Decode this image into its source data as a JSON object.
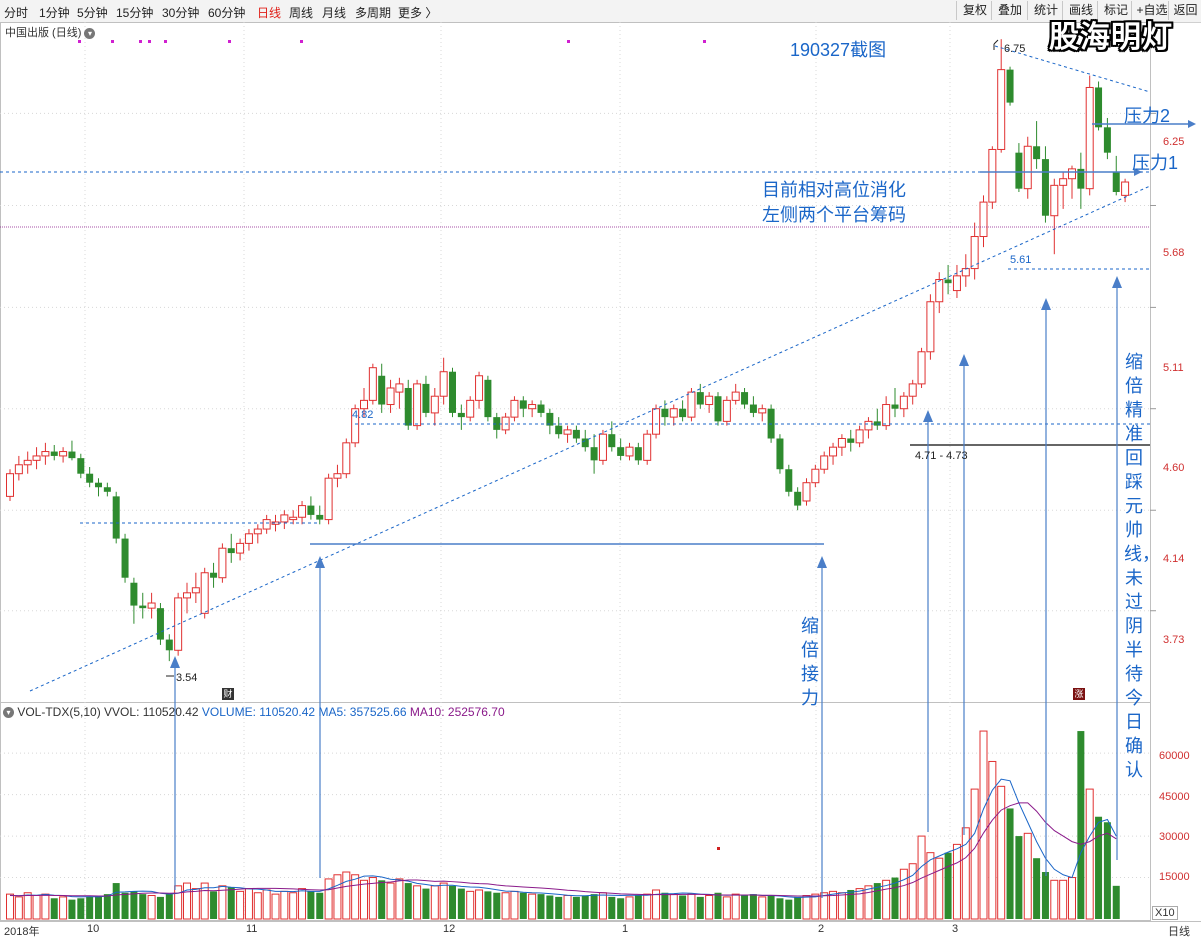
{
  "toolbar": {
    "periods": [
      "分时",
      "1分钟",
      "5分钟",
      "15分钟",
      "30分钟",
      "60分钟",
      "日线",
      "周线",
      "月线",
      "多周期",
      "更多 〉"
    ],
    "active_period": "日线",
    "right_buttons": [
      "复权",
      "叠加",
      "统计",
      "画线",
      "标记",
      "+自选",
      "返回"
    ]
  },
  "logo": "股海明灯",
  "stock_title": "中国出版 (日线)",
  "annotations": {
    "date_note": "190327截图",
    "high_label": "6.75",
    "low_label": "3.54",
    "level_482": "4.82",
    "level_561": "5.61",
    "range_label": "4.71 - 4.73",
    "pressure2": "压力2",
    "pressure1": "压力1",
    "note_line1": "目前相对高位消化",
    "note_line2": "左侧两个平台筹码",
    "shrink_label": "缩倍接力",
    "right_note": "缩倍精准回踩元帅线，未过阴半待今日确认",
    "cai_badge": "财",
    "zhang_badge": "涨"
  },
  "price_axis": {
    "labels": [
      "6.25",
      "5.68",
      "5.11",
      "4.60",
      "4.14",
      "3.73"
    ]
  },
  "volume_legend": {
    "name": "VOL-TDX(5,10)",
    "vvol": "VVOL: 110520.42",
    "volume": "VOLUME: 110520.42",
    "ma5": "MA5: 357525.66",
    "ma10": "MA10: 252576.70"
  },
  "volume_axis": {
    "labels": [
      "60000",
      "45000",
      "30000",
      "15000"
    ],
    "unit": "X10"
  },
  "x_axis": {
    "labels": [
      "2018年",
      "10",
      "11",
      "12",
      "1",
      "2",
      "3"
    ],
    "right_label": "日线"
  },
  "colors": {
    "up": "#e03030",
    "down": "#2e8b2e",
    "annotation": "#1a66c8",
    "ma5": "#1a66c8",
    "ma10": "#8a1a8a"
  },
  "chart_data": {
    "type": "candlestick",
    "ohlc": [
      [
        4.2,
        4.32,
        4.18,
        4.3
      ],
      [
        4.3,
        4.38,
        4.27,
        4.34
      ],
      [
        4.34,
        4.4,
        4.3,
        4.36
      ],
      [
        4.36,
        4.42,
        4.32,
        4.38
      ],
      [
        4.38,
        4.44,
        4.34,
        4.4
      ],
      [
        4.4,
        4.43,
        4.36,
        4.38
      ],
      [
        4.38,
        4.42,
        4.35,
        4.4
      ],
      [
        4.4,
        4.45,
        4.36,
        4.37
      ],
      [
        4.37,
        4.39,
        4.28,
        4.3
      ],
      [
        4.3,
        4.33,
        4.24,
        4.26
      ],
      [
        4.26,
        4.28,
        4.2,
        4.24
      ],
      [
        4.24,
        4.26,
        4.2,
        4.22
      ],
      [
        4.2,
        4.22,
        4.0,
        4.02
      ],
      [
        4.02,
        4.04,
        3.84,
        3.86
      ],
      [
        3.84,
        3.86,
        3.68,
        3.75
      ],
      [
        3.75,
        3.8,
        3.7,
        3.74
      ],
      [
        3.74,
        3.8,
        3.7,
        3.76
      ],
      [
        3.74,
        3.76,
        3.6,
        3.62
      ],
      [
        3.62,
        3.64,
        3.54,
        3.58
      ],
      [
        3.58,
        3.8,
        3.56,
        3.78
      ],
      [
        3.78,
        3.84,
        3.72,
        3.8
      ],
      [
        3.8,
        3.88,
        3.76,
        3.82
      ],
      [
        3.72,
        3.9,
        3.7,
        3.88
      ],
      [
        3.88,
        3.92,
        3.82,
        3.86
      ],
      [
        3.86,
        4.0,
        3.84,
        3.98
      ],
      [
        3.98,
        4.04,
        3.92,
        3.96
      ],
      [
        3.96,
        4.02,
        3.93,
        4.0
      ],
      [
        4.0,
        4.06,
        3.97,
        4.04
      ],
      [
        4.04,
        4.08,
        4.0,
        4.06
      ],
      [
        4.06,
        4.12,
        4.04,
        4.1
      ],
      [
        4.08,
        4.12,
        4.05,
        4.09
      ],
      [
        4.09,
        4.14,
        4.06,
        4.12
      ],
      [
        4.1,
        4.14,
        4.08,
        4.11
      ],
      [
        4.11,
        4.18,
        4.08,
        4.16
      ],
      [
        4.16,
        4.2,
        4.1,
        4.12
      ],
      [
        4.12,
        4.16,
        4.08,
        4.1
      ],
      [
        4.1,
        4.3,
        4.08,
        4.28
      ],
      [
        4.28,
        4.34,
        4.24,
        4.3
      ],
      [
        4.3,
        4.46,
        4.28,
        4.44
      ],
      [
        4.44,
        4.62,
        4.42,
        4.6
      ],
      [
        4.6,
        4.7,
        4.56,
        4.64
      ],
      [
        4.64,
        4.82,
        4.62,
        4.8
      ],
      [
        4.76,
        4.82,
        4.58,
        4.62
      ],
      [
        4.62,
        4.74,
        4.58,
        4.7
      ],
      [
        4.68,
        4.75,
        4.6,
        4.72
      ],
      [
        4.7,
        4.74,
        4.5,
        4.52
      ],
      [
        4.52,
        4.74,
        4.5,
        4.72
      ],
      [
        4.72,
        4.76,
        4.56,
        4.58
      ],
      [
        4.58,
        4.7,
        4.52,
        4.66
      ],
      [
        4.66,
        4.85,
        4.62,
        4.78
      ],
      [
        4.78,
        4.8,
        4.56,
        4.58
      ],
      [
        4.58,
        4.62,
        4.5,
        4.56
      ],
      [
        4.56,
        4.66,
        4.54,
        4.64
      ],
      [
        4.64,
        4.78,
        4.6,
        4.76
      ],
      [
        4.74,
        4.76,
        4.54,
        4.56
      ],
      [
        4.56,
        4.58,
        4.46,
        4.5
      ],
      [
        4.5,
        4.58,
        4.48,
        4.56
      ],
      [
        4.56,
        4.66,
        4.54,
        4.64
      ],
      [
        4.64,
        4.66,
        4.56,
        4.6
      ],
      [
        4.6,
        4.64,
        4.56,
        4.62
      ],
      [
        4.62,
        4.64,
        4.56,
        4.58
      ],
      [
        4.58,
        4.6,
        4.48,
        4.52
      ],
      [
        4.52,
        4.56,
        4.46,
        4.48
      ],
      [
        4.48,
        4.52,
        4.44,
        4.5
      ],
      [
        4.5,
        4.52,
        4.44,
        4.46
      ],
      [
        4.46,
        4.5,
        4.4,
        4.42
      ],
      [
        4.42,
        4.48,
        4.3,
        4.36
      ],
      [
        4.36,
        4.5,
        4.34,
        4.48
      ],
      [
        4.48,
        4.54,
        4.4,
        4.42
      ],
      [
        4.42,
        4.46,
        4.36,
        4.38
      ],
      [
        4.38,
        4.44,
        4.36,
        4.42
      ],
      [
        4.42,
        4.44,
        4.34,
        4.36
      ],
      [
        4.36,
        4.5,
        4.34,
        4.48
      ],
      [
        4.48,
        4.62,
        4.46,
        4.6
      ],
      [
        4.6,
        4.64,
        4.52,
        4.56
      ],
      [
        4.56,
        4.62,
        4.52,
        4.6
      ],
      [
        4.6,
        4.64,
        4.54,
        4.56
      ],
      [
        4.56,
        4.7,
        4.54,
        4.68
      ],
      [
        4.68,
        4.72,
        4.6,
        4.62
      ],
      [
        4.62,
        4.68,
        4.58,
        4.66
      ],
      [
        4.66,
        4.68,
        4.52,
        4.54
      ],
      [
        4.54,
        4.66,
        4.52,
        4.64
      ],
      [
        4.64,
        4.72,
        4.62,
        4.68
      ],
      [
        4.68,
        4.7,
        4.6,
        4.62
      ],
      [
        4.62,
        4.66,
        4.56,
        4.58
      ],
      [
        4.58,
        4.62,
        4.54,
        4.6
      ],
      [
        4.6,
        4.62,
        4.44,
        4.46
      ],
      [
        4.46,
        4.48,
        4.3,
        4.32
      ],
      [
        4.32,
        4.34,
        4.2,
        4.22
      ],
      [
        4.22,
        4.24,
        4.14,
        4.16
      ],
      [
        4.18,
        4.28,
        4.16,
        4.26
      ],
      [
        4.26,
        4.34,
        4.24,
        4.32
      ],
      [
        4.32,
        4.4,
        4.3,
        4.38
      ],
      [
        4.38,
        4.44,
        4.34,
        4.42
      ],
      [
        4.42,
        4.48,
        4.38,
        4.46
      ],
      [
        4.46,
        4.5,
        4.4,
        4.44
      ],
      [
        4.44,
        4.52,
        4.42,
        4.5
      ],
      [
        4.5,
        4.56,
        4.46,
        4.54
      ],
      [
        4.54,
        4.6,
        4.5,
        4.52
      ],
      [
        4.52,
        4.66,
        4.5,
        4.62
      ],
      [
        4.62,
        4.7,
        4.56,
        4.6
      ],
      [
        4.6,
        4.68,
        4.56,
        4.66
      ],
      [
        4.66,
        4.74,
        4.62,
        4.72
      ],
      [
        4.72,
        4.9,
        4.7,
        4.88
      ],
      [
        4.88,
        5.18,
        4.84,
        5.14
      ],
      [
        5.14,
        5.3,
        5.08,
        5.26
      ],
      [
        5.26,
        5.34,
        5.18,
        5.24
      ],
      [
        5.2,
        5.34,
        5.16,
        5.28
      ],
      [
        5.28,
        5.4,
        5.22,
        5.32
      ],
      [
        5.32,
        5.58,
        5.26,
        5.5
      ],
      [
        5.5,
        5.74,
        5.44,
        5.7
      ],
      [
        5.7,
        6.04,
        5.66,
        6.02
      ],
      [
        6.02,
        6.75,
        6.0,
        6.54
      ],
      [
        6.54,
        6.56,
        6.3,
        6.32
      ],
      [
        6.0,
        6.06,
        5.76,
        5.78
      ],
      [
        5.78,
        6.1,
        5.72,
        6.04
      ],
      [
        6.04,
        6.2,
        5.9,
        5.96
      ],
      [
        5.96,
        6.04,
        5.58,
        5.62
      ],
      [
        5.62,
        5.84,
        5.4,
        5.8
      ],
      [
        5.8,
        5.88,
        5.66,
        5.84
      ],
      [
        5.84,
        5.92,
        5.72,
        5.9
      ],
      [
        5.9,
        6.0,
        5.66,
        5.78
      ],
      [
        5.78,
        6.5,
        5.74,
        6.42
      ],
      [
        6.42,
        6.46,
        6.14,
        6.16
      ],
      [
        6.16,
        6.22,
        5.96,
        6.0
      ],
      [
        5.88,
        5.98,
        5.74,
        5.76
      ],
      [
        5.74,
        5.84,
        5.7,
        5.82
      ]
    ],
    "volume": [
      9000,
      8000,
      9500,
      8500,
      9000,
      7500,
      8000,
      7000,
      7500,
      8000,
      8500,
      9000,
      13000,
      9500,
      10000,
      9000,
      8500,
      8000,
      9000,
      12000,
      13000,
      11000,
      13000,
      10000,
      12000,
      11500,
      10000,
      11000,
      9500,
      10500,
      9000,
      10000,
      9500,
      11000,
      10000,
      9500,
      14500,
      16000,
      17000,
      16000,
      14000,
      15000,
      14000,
      13000,
      14500,
      13000,
      12000,
      11000,
      12000,
      13000,
      12000,
      11000,
      10000,
      10500,
      10000,
      9500,
      9500,
      10000,
      9500,
      9000,
      9000,
      8500,
      8000,
      8500,
      8000,
      8500,
      9000,
      9500,
      8000,
      7500,
      8000,
      8500,
      9000,
      10500,
      9500,
      9000,
      8500,
      9000,
      8000,
      8500,
      9500,
      8000,
      9000,
      8500,
      9000,
      8000,
      8500,
      7500,
      7000,
      8000,
      8500,
      9000,
      9500,
      10000,
      9500,
      10500,
      11000,
      12000,
      13000,
      14000,
      15000,
      18000,
      20000,
      30000,
      24000,
      22000,
      24000,
      27000,
      33000,
      47000,
      68000,
      57000,
      48000,
      40000,
      30000,
      31000,
      22000,
      17000,
      14000,
      14000,
      15000,
      68000,
      47000,
      37000,
      35000,
      12000
    ],
    "ma5": [
      8600,
      8400,
      8700,
      8600,
      8900,
      8600,
      8500,
      8100,
      8000,
      8100,
      8000,
      8300,
      9700,
      9800,
      10000,
      10100,
      10000,
      9300,
      9000,
      9300,
      10500,
      10700,
      11300,
      11300,
      11800,
      11500,
      11300,
      10900,
      10800,
      10500,
      10000,
      10000,
      9900,
      10200,
      10000,
      10000,
      10900,
      12200,
      13600,
      14400,
      15500,
      15600,
      15200,
      14400,
      14100,
      13700,
      12900,
      12500,
      12000,
      12200,
      12200,
      11800,
      11600,
      11500,
      11100,
      10600,
      10100,
      10000,
      9700,
      9500,
      9400,
      9200,
      8900,
      8600,
      8400,
      8400,
      8600,
      8700,
      8600,
      8500,
      8600,
      8600,
      8600,
      8900,
      9100,
      9200,
      9400,
      9300,
      9000,
      8900,
      8700,
      8600,
      8700,
      8600,
      8800,
      8500,
      8500,
      8300,
      8000,
      7800,
      7900,
      8000,
      8500,
      9000,
      9400,
      9700,
      10100,
      10800,
      11500,
      12100,
      13000,
      14200,
      15800,
      19000,
      21400,
      22800,
      24200,
      25400,
      27000,
      31000,
      39800,
      46600,
      50600,
      50000,
      42000,
      35000,
      28000,
      22000,
      18000,
      16000,
      15000,
      24000,
      30000,
      35000,
      36000,
      30000
    ],
    "ma10": [
      8500,
      8400,
      8500,
      8500,
      8600,
      8500,
      8500,
      8400,
      8400,
      8400,
      8300,
      8300,
      8700,
      8900,
      9100,
      9300,
      9400,
      9400,
      9300,
      9400,
      9800,
      10000,
      10300,
      10200,
      10400,
      10600,
      10800,
      11000,
      11100,
      11100,
      11100,
      11000,
      10900,
      10700,
      10600,
      10500,
      10600,
      11200,
      11800,
      12200,
      12600,
      12900,
      13200,
      13400,
      13800,
      14100,
      14100,
      13900,
      13600,
      13700,
      13500,
      13300,
      13000,
      12800,
      12700,
      12300,
      12000,
      11800,
      11600,
      11400,
      11200,
      11000,
      10700,
      10400,
      10200,
      9900,
      9700,
      9500,
      9300,
      9100,
      9000,
      8900,
      8800,
      8800,
      8800,
      8800,
      8900,
      8900,
      8900,
      8800,
      8700,
      8700,
      8700,
      8700,
      8700,
      8600,
      8600,
      8500,
      8400,
      8300,
      8300,
      8300,
      8400,
      8500,
      8700,
      8900,
      9100,
      9600,
      10200,
      10800,
      11300,
      12100,
      13200,
      14800,
      16200,
      17600,
      19000,
      20300,
      22200,
      25600,
      31100,
      35800,
      39400,
      41000,
      42000,
      42000,
      39000,
      35000,
      32000,
      30000,
      28000,
      27000,
      28000,
      30000,
      31000,
      29000
    ],
    "price_range": [
      3.4,
      6.85
    ],
    "volume_range": [
      0,
      72000
    ]
  }
}
